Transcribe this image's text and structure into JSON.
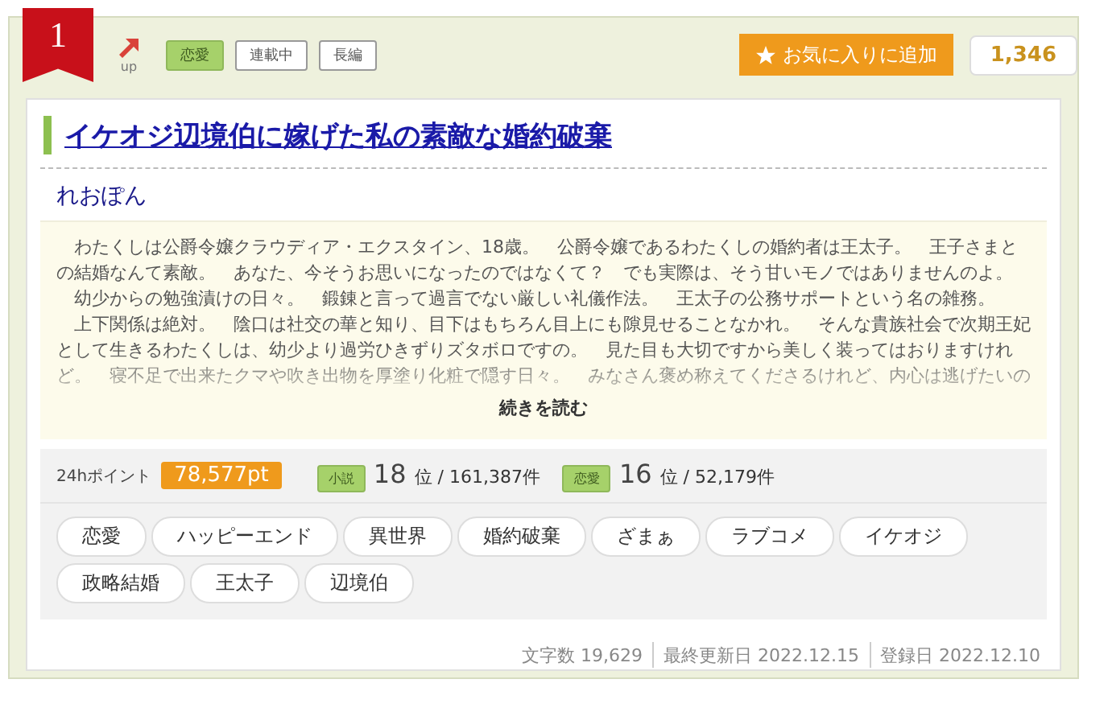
{
  "rank": "1",
  "trend": {
    "label": "up"
  },
  "labels": [
    {
      "text": "恋愛",
      "kind": "genre"
    },
    {
      "text": "連載中",
      "kind": "plain"
    },
    {
      "text": "長編",
      "kind": "plain"
    }
  ],
  "favorite_button": {
    "label": "お気に入りに追加"
  },
  "favorite_count": "1,346",
  "title": "イケオジ辺境伯に嫁げた私の素敵な婚約破棄",
  "author": "れおぽん",
  "synopsis": [
    "　わたくしは公爵令嬢クラウディア・エクスタイン、18歳。　公爵令嬢であるわたくしの婚約者は王太子。　王子さまとの結婚なんて素敵。　あなた、今そうお思いになったのではなくて？　でも実際は、そう甘いモノではありませんのよ。",
    "　幼少からの勉強漬けの日々。　鍛錬と言って過言でない厳しい礼儀作法。　王太子の公務サポートという名の雑務。",
    "　上下関係は絶対。　陰口は社交の華と知り、目下はもちろん目上にも隙見せることなかれ。　そんな貴族社会で次期王妃として生きるわたくしは、幼少より過労ひきずりズタボロですの。　見た目も大切ですから美しく装ってはおりますけれど。　寝不足で出来たクマや吹き出物を厚塗り化粧で隠す日々。　みなさん褒め称えてくださるけれど、内心は逃げたいの"
  ],
  "read_more": "続きを読む",
  "points": {
    "label": "24hポイント",
    "value": "78,577pt"
  },
  "rankings": [
    {
      "category": "小説",
      "rank": "18",
      "total": "位 / 161,387件"
    },
    {
      "category": "恋愛",
      "rank": "16",
      "total": "位 / 52,179件"
    }
  ],
  "tags": [
    "恋愛",
    "ハッピーエンド",
    "異世界",
    "婚約破棄",
    "ざまぁ",
    "ラブコメ",
    "イケオジ",
    "政略結婚",
    "王太子",
    "辺境伯"
  ],
  "footer": [
    {
      "label": "文字数",
      "value": "19,629"
    },
    {
      "label": "最終更新日",
      "value": "2022.12.15"
    },
    {
      "label": "登録日",
      "value": "2022.12.10"
    }
  ]
}
